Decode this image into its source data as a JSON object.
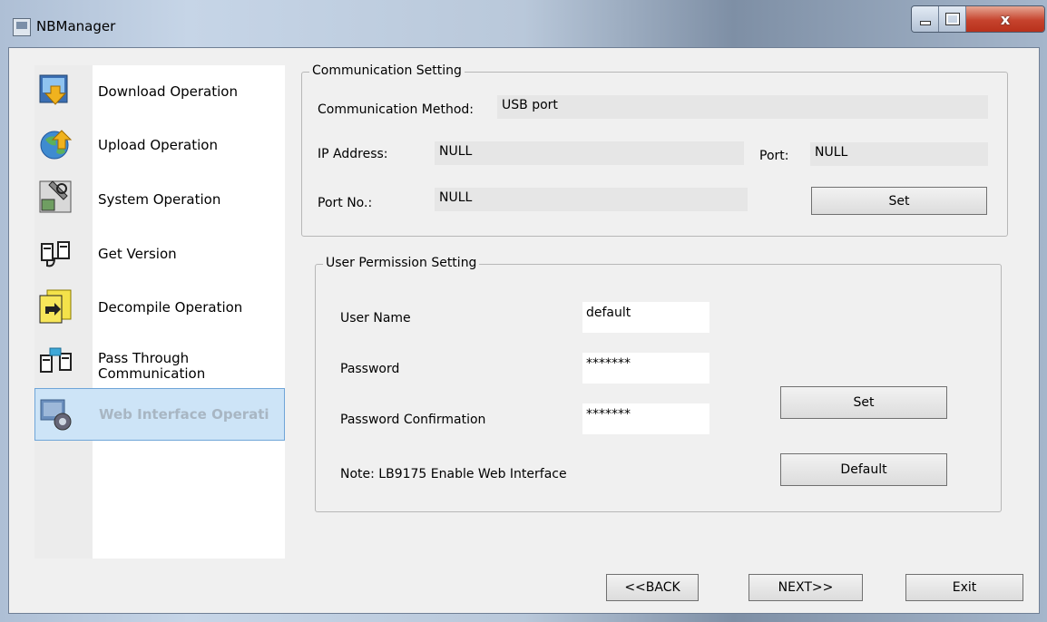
{
  "window": {
    "title": "NBManager",
    "buttons": {
      "minimize": "minimize",
      "maximize": "maximize",
      "close": "x"
    }
  },
  "sidebar": {
    "items": [
      {
        "label": "Download Operation",
        "icon": "download-icon",
        "active": false
      },
      {
        "label": "Upload Operation",
        "icon": "upload-icon",
        "active": false
      },
      {
        "label": "System Operation",
        "icon": "system-icon",
        "active": false
      },
      {
        "label": "Get Version",
        "icon": "version-icon",
        "active": false
      },
      {
        "label": "Decompile Operation",
        "icon": "decompile-icon",
        "active": false
      },
      {
        "label_line1": "Pass Through",
        "label_line2": "Communication",
        "icon": "pass-through-icon",
        "active": false
      },
      {
        "label": "Web Interface Operati",
        "icon": "web-interface-icon",
        "active": true
      }
    ]
  },
  "communication": {
    "legend": "Communication Setting",
    "method_label": "Communication Method:",
    "method_value": "USB port",
    "ip_label": "IP Address:",
    "ip_value": "NULL",
    "port_label": "Port:",
    "port_value": "NULL",
    "portno_label": "Port No.:",
    "portno_value": "NULL",
    "set_label": "Set"
  },
  "permission": {
    "legend": "User Permission Setting",
    "user_label": "User Name",
    "user_value": "default",
    "password_label": "Password",
    "password_value": "*******",
    "confirm_label": "Password Confirmation",
    "confirm_value": "*******",
    "set_label": "Set",
    "default_label": "Default",
    "note": "Note: LB9175 Enable Web Interface"
  },
  "footer": {
    "back_label": "<<BACK",
    "next_label": "NEXT>>",
    "exit_label": "Exit"
  },
  "colors": {
    "active_bg": "#cde4f7",
    "active_border": "#6fa5d8",
    "close_red": "#c6432d"
  }
}
